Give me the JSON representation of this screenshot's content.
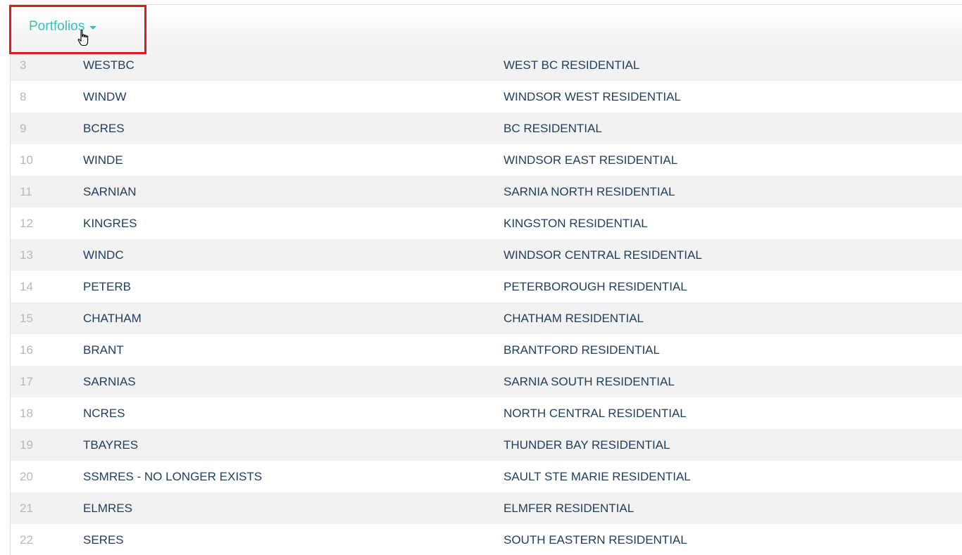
{
  "header": {
    "menu_label": "Portfolios"
  },
  "rows": [
    {
      "id": "3",
      "code": "WESTBC",
      "name": "WEST BC RESIDENTIAL"
    },
    {
      "id": "8",
      "code": "WINDW",
      "name": "WINDSOR WEST RESIDENTIAL"
    },
    {
      "id": "9",
      "code": "BCRES",
      "name": "BC RESIDENTIAL"
    },
    {
      "id": "10",
      "code": "WINDE",
      "name": "WINDSOR EAST RESIDENTIAL"
    },
    {
      "id": "11",
      "code": "SARNIAN",
      "name": "SARNIA NORTH RESIDENTIAL"
    },
    {
      "id": "12",
      "code": "KINGRES",
      "name": "KINGSTON RESIDENTIAL"
    },
    {
      "id": "13",
      "code": "WINDC",
      "name": "WINDSOR CENTRAL RESIDENTIAL"
    },
    {
      "id": "14",
      "code": "PETERB",
      "name": "PETERBOROUGH RESIDENTIAL"
    },
    {
      "id": "15",
      "code": "CHATHAM",
      "name": "CHATHAM RESIDENTIAL"
    },
    {
      "id": "16",
      "code": "BRANT",
      "name": "BRANTFORD RESIDENTIAL"
    },
    {
      "id": "17",
      "code": "SARNIAS",
      "name": "SARNIA SOUTH RESIDENTIAL"
    },
    {
      "id": "18",
      "code": "NCRES",
      "name": "NORTH CENTRAL RESIDENTIAL"
    },
    {
      "id": "19",
      "code": "TBAYRES",
      "name": "THUNDER BAY RESIDENTIAL"
    },
    {
      "id": "20",
      "code": "SSMRES - NO LONGER EXISTS",
      "name": "SAULT STE MARIE RESIDENTIAL"
    },
    {
      "id": "21",
      "code": "ELMRES",
      "name": "ELMFER RESIDENTIAL"
    },
    {
      "id": "22",
      "code": "SERES",
      "name": "SOUTH EASTERN RESIDENTIAL"
    }
  ]
}
